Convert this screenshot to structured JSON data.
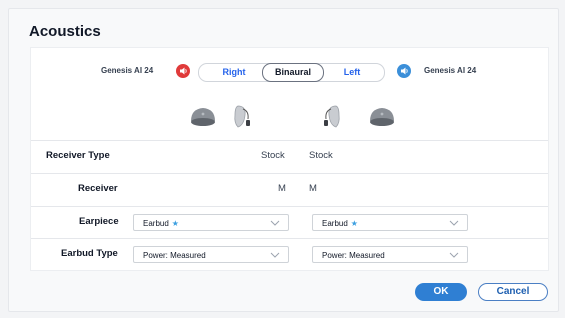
{
  "dialog": {
    "title": "Acoustics"
  },
  "header": {
    "left_device": "Genesis AI 24",
    "right_device": "Genesis AI 24",
    "left_side_color": "#e03a3a",
    "right_side_color": "#3b8fd9",
    "segments": [
      "Right",
      "Binaural",
      "Left"
    ],
    "active_segment": "Binaural"
  },
  "rows": {
    "receiver_type": {
      "label": "Receiver Type",
      "left": "Stock",
      "right": "Stock"
    },
    "receiver": {
      "label": "Receiver",
      "left": "M",
      "right": "M"
    },
    "earpiece": {
      "label": "Earpiece",
      "left": "Earbud",
      "right": "Earbud"
    },
    "earbud_type": {
      "label": "Earbud Type",
      "left": "Power: Measured",
      "right": "Power: Measured"
    }
  },
  "buttons": {
    "ok": "OK",
    "cancel": "Cancel"
  },
  "colors": {
    "accent": "#2f7fd3",
    "star": "#3b9fe0"
  }
}
